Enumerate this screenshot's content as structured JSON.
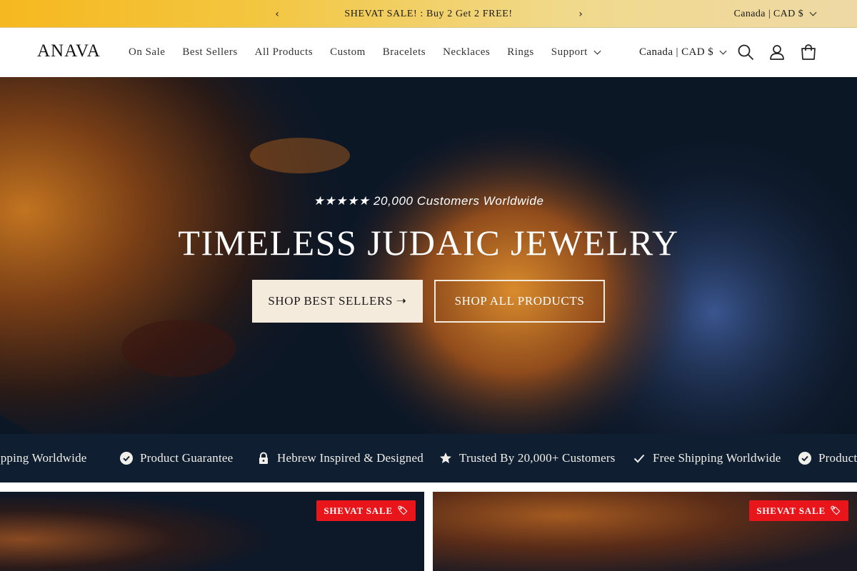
{
  "announcement": {
    "message": "SHEVAT SALE! : Buy 2 Get 2 FREE!",
    "prev_arrow": "‹",
    "next_arrow": "›",
    "locale": "Canada | CAD $"
  },
  "header": {
    "logo": "ANAVA",
    "nav": [
      "On Sale",
      "Best Sellers",
      "All Products",
      "Custom",
      "Bracelets",
      "Necklaces",
      "Rings",
      "Support"
    ],
    "locale": "Canada | CAD $",
    "icons": [
      "search-icon",
      "account-icon",
      "cart-icon"
    ]
  },
  "hero": {
    "rating": "★★★★★ 20,000 Customers Worldwide",
    "title": "TIMELESS JUDAIC JEWELRY",
    "primary_button": "SHOP BEST SELLERS ➝",
    "secondary_button": "SHOP ALL PRODUCTS"
  },
  "features": [
    {
      "icon": "check-icon",
      "label": "Free Shipping Worldwide"
    },
    {
      "icon": "check-circle-icon",
      "label": "Product Guarantee"
    },
    {
      "icon": "lock-icon",
      "label": "Hebrew Inspired & Designed"
    },
    {
      "icon": "star-icon",
      "label": "Trusted By 20,000+ Customers"
    },
    {
      "icon": "check-icon",
      "label": "Free Shipping Worldwide"
    },
    {
      "icon": "check-circle-icon",
      "label": "Product Guarantee"
    }
  ],
  "cards": [
    {
      "badge": "SHEVAT SALE"
    },
    {
      "badge": "SHEVAT SALE"
    }
  ],
  "colors": {
    "announcement_start": "#f6b81f",
    "announcement_end": "#eed9a6",
    "hero_navy": "#0c1726",
    "strip_navy": "#0f1e31",
    "button_cream": "#f5ebdd",
    "sale_red": "#e8151b"
  }
}
